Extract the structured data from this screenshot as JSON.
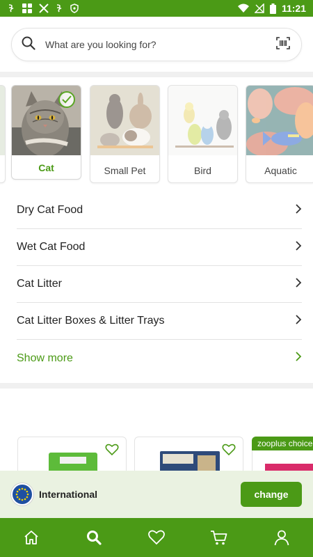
{
  "status_bar": {
    "time": "11:21",
    "left_icons": [
      "accessibility-icon",
      "app-grid-icon",
      "x-icon",
      "accessibility-icon",
      "vpn-icon"
    ],
    "right_icons": [
      "wifi-icon",
      "signal-icon",
      "battery-icon"
    ]
  },
  "search": {
    "placeholder": "What are you looking for?",
    "icon": "search-icon",
    "scan_icon": "barcode-scan-icon"
  },
  "categories": [
    {
      "label": "Cat",
      "selected": true
    },
    {
      "label": "Small Pet",
      "selected": false
    },
    {
      "label": "Bird",
      "selected": false
    },
    {
      "label": "Aquatic",
      "selected": false
    }
  ],
  "category_list": [
    {
      "label": "Dry Cat Food"
    },
    {
      "label": "Wet Cat Food"
    },
    {
      "label": "Cat Litter"
    },
    {
      "label": "Cat Litter Boxes & Litter Trays"
    }
  ],
  "show_more_label": "Show more",
  "products": {
    "promo_label": "zooplus choice"
  },
  "international": {
    "label": "International",
    "change_label": "change"
  },
  "bottom_nav": [
    "home-icon",
    "search-icon",
    "heart-icon",
    "cart-icon",
    "user-icon"
  ],
  "colors": {
    "brand_green": "#4b9a16",
    "banner_bg": "#eaf2e1"
  }
}
